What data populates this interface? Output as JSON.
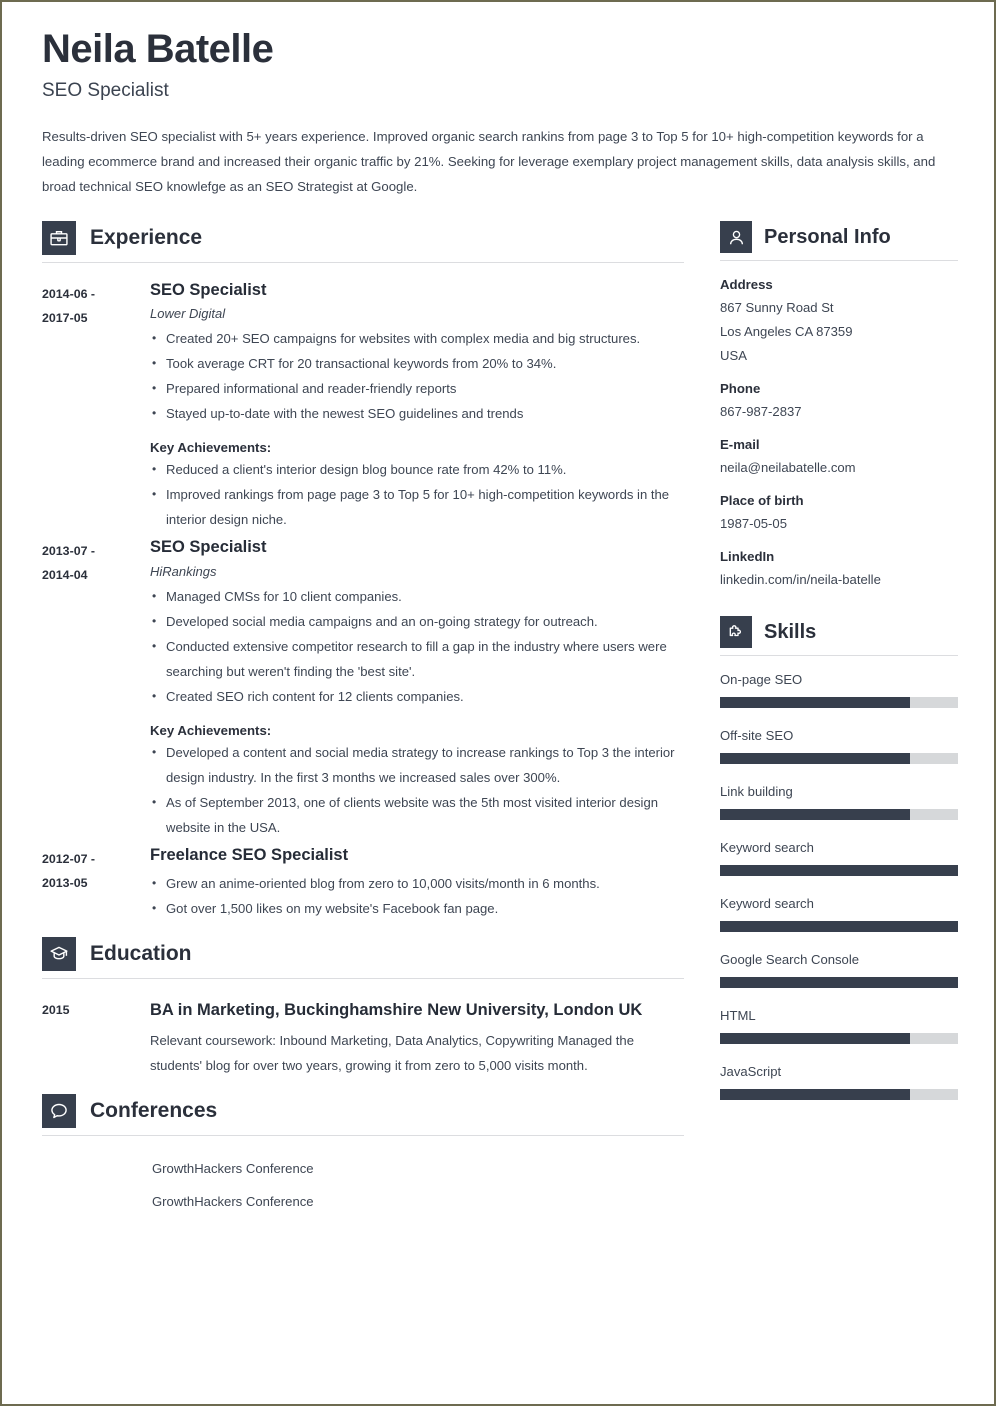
{
  "header": {
    "name": "Neila Batelle",
    "job_title": "SEO Specialist",
    "summary": "Results-driven SEO specialist with 5+ years experience. Improved organic search rankins from page 3 to Top 5 for 10+ high-competition keywords for a leading ecommerce brand and increased their organic traffic by 21%. Seeking for leverage exemplary project management skills, data analysis skills, and broad technical SEO knowlefge as an SEO Strategist at Google."
  },
  "sections": {
    "experience": {
      "title": "Experience",
      "icon": "briefcase-icon"
    },
    "education": {
      "title": "Education",
      "icon": "graduation-cap-icon"
    },
    "conferences": {
      "title": "Conferences",
      "icon": "speech-bubble-icon"
    },
    "personal_info": {
      "title": "Personal Info",
      "icon": "person-icon"
    },
    "skills": {
      "title": "Skills",
      "icon": "puzzle-piece-icon"
    }
  },
  "experience": [
    {
      "date_start": "2014-06 -",
      "date_end": "2017-05",
      "role": "SEO Specialist",
      "company": "Lower Digital",
      "bullets": [
        "Created 20+ SEO campaigns for websites with complex media and big structures.",
        "Took average CRT for 20 transactional keywords from 20% to 34%.",
        "Prepared informational and reader-friendly reports",
        "Stayed up-to-date with the newest SEO guidelines and trends"
      ],
      "achievements_label": "Key Achievements:",
      "achievements": [
        "Reduced a client's interior design blog bounce rate from 42% to 11%.",
        "Improved rankings from page page 3 to Top 5 for 10+ high-competition keywords in the interior design niche."
      ]
    },
    {
      "date_start": "2013-07 -",
      "date_end": "2014-04",
      "role": "SEO Specialist",
      "company": "HiRankings",
      "bullets": [
        "Managed CMSs for 10 client companies.",
        "Developed social media campaigns and an on-going strategy for outreach.",
        "Conducted extensive competitor research to fill a gap in the industry where users were searching but weren't finding the 'best site'.",
        "Created SEO rich content for 12 clients companies."
      ],
      "achievements_label": "Key Achievements:",
      "achievements": [
        "Developed a content and social media strategy to increase rankings to Top 3 the interior design industry. In the first 3 months we increased sales over 300%.",
        "As of September 2013, one of clients website was the 5th most visited interior design website in the USA."
      ]
    },
    {
      "date_start": "2012-07 -",
      "date_end": "2013-05",
      "role": "Freelance SEO Specialist",
      "company": "",
      "bullets": [
        "Grew an anime-oriented blog from zero to 10,000 visits/month in 6 months.",
        "Got over 1,500 likes on my website's Facebook fan page."
      ],
      "achievements_label": "",
      "achievements": []
    }
  ],
  "education": [
    {
      "date": "2015",
      "degree": "BA in Marketing, Buckinghamshire New University, London UK",
      "description": "Relevant coursework: Inbound Marketing, Data Analytics, Copywriting Managed the students' blog for over two years, growing it from zero to 5,000 visits month."
    }
  ],
  "conferences": [
    "GrowthHackers Conference",
    "GrowthHackers Conference"
  ],
  "personal_info": [
    {
      "label": "Address",
      "value": "867 Sunny Road St\nLos Angeles CA 87359\nUSA"
    },
    {
      "label": "Phone",
      "value": "867-987-2837"
    },
    {
      "label": "E-mail",
      "value": "neila@neilabatelle.com"
    },
    {
      "label": "Place of birth",
      "value": "1987-05-05"
    },
    {
      "label": "LinkedIn",
      "value": "linkedin.com/in/neila-batelle"
    }
  ],
  "skills": [
    {
      "name": "On-page SEO",
      "level": 80
    },
    {
      "name": "Off-site SEO",
      "level": 80
    },
    {
      "name": "Link building",
      "level": 80
    },
    {
      "name": "Keyword search",
      "level": 100
    },
    {
      "name": "Keyword search",
      "level": 100
    },
    {
      "name": "Google Search Console",
      "level": 100
    },
    {
      "name": "HTML",
      "level": 80
    },
    {
      "name": "JavaScript",
      "level": 80
    }
  ],
  "colors": {
    "accent_dark": "#373f4d",
    "text_heading": "#2b303b",
    "text_body": "#3e4653",
    "track_gray": "#d6d8da",
    "page_border": "#6d6b50"
  }
}
